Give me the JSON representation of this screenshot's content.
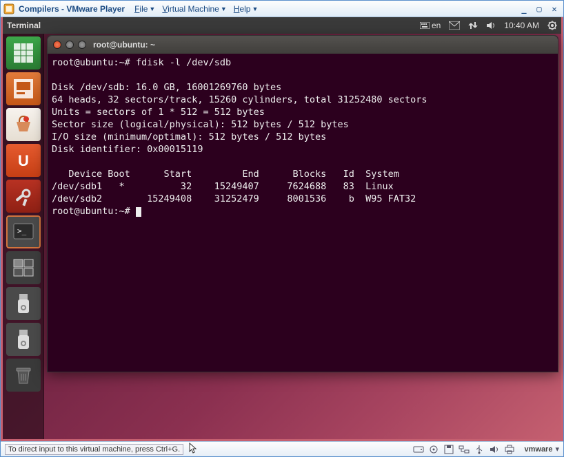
{
  "vmware": {
    "title": "Compilers - VMware Player",
    "menu": {
      "file": "File",
      "vm": "Virtual Machine",
      "help": "Help"
    },
    "status_hint": "To direct input to this virtual machine, press Ctrl+G.",
    "logo": "vmware"
  },
  "gnome": {
    "app_title": "Terminal",
    "lang": "en",
    "time": "10:40 AM"
  },
  "launcher": {
    "items": [
      "libreoffice-calc",
      "libreoffice-impress",
      "software-center",
      "ubuntu-one",
      "settings",
      "terminal",
      "workspace-switcher",
      "usb-drive-1",
      "usb-drive-2",
      "trash"
    ]
  },
  "terminal": {
    "title": "root@ubuntu: ~",
    "prompt": "root@ubuntu:~#",
    "command": "fdisk -l /dev/sdb",
    "disk_header": "Disk /dev/sdb: 16.0 GB, 16001269760 bytes",
    "geometry": "64 heads, 32 sectors/track, 15260 cylinders, total 31252480 sectors",
    "units": "Units = sectors of 1 * 512 = 512 bytes",
    "sector_size": "Sector size (logical/physical): 512 bytes / 512 bytes",
    "io_size": "I/O size (minimum/optimal): 512 bytes / 512 bytes",
    "disk_id": "Disk identifier: 0x00015119",
    "columns_line": "   Device Boot      Start         End      Blocks   Id  System",
    "row1": "/dev/sdb1   *          32    15249407     7624688   83  Linux",
    "row2": "/dev/sdb2        15249408    31252479     8001536    b  W95 FAT32",
    "partitions": [
      {
        "device": "/dev/sdb1",
        "boot": "*",
        "start": 32,
        "end": 15249407,
        "blocks": 7624688,
        "id": "83",
        "system": "Linux"
      },
      {
        "device": "/dev/sdb2",
        "boot": "",
        "start": 15249408,
        "end": 31252479,
        "blocks": 8001536,
        "id": "b",
        "system": "W95 FAT32"
      }
    ]
  }
}
